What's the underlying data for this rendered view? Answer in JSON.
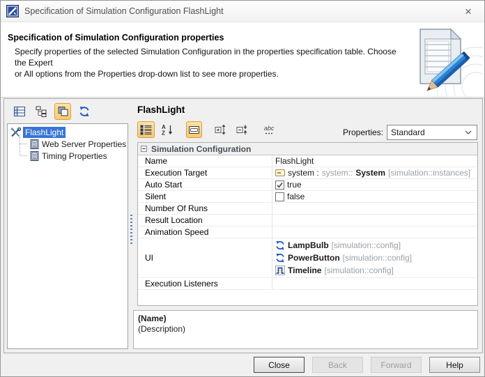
{
  "window": {
    "title": "Specification of Simulation Configuration FlashLight",
    "close_glyph": "×"
  },
  "header": {
    "title": "Specification of Simulation Configuration properties",
    "description_line1": "Specify properties of the selected Simulation Configuration in the properties specification table. Choose the Expert",
    "description_line2": "or All options from the Properties drop-down list to see more properties."
  },
  "left_panel": {
    "toolbar": [
      {
        "name": "element-list-button",
        "selected": false
      },
      {
        "name": "containment-tree-button",
        "selected": false
      },
      {
        "name": "group-view-button",
        "selected": true
      },
      {
        "name": "refresh-button",
        "selected": false
      }
    ],
    "tree": {
      "root_label": "FlashLight",
      "children": [
        "Web Server Properties",
        "Timing Properties"
      ]
    }
  },
  "main": {
    "title": "FlashLight",
    "toolbar": [
      {
        "name": "categorized-view-button",
        "selected": true
      },
      {
        "name": "sort-alphabetically-button",
        "selected": false
      },
      {
        "name": "show-description-button",
        "selected": true
      },
      {
        "name": "expand-nodes-button",
        "selected": false
      },
      {
        "name": "collapse-nodes-button",
        "selected": false
      },
      {
        "name": "customize-button",
        "selected": false
      }
    ],
    "properties": {
      "label": "Properties:",
      "value": "Standard"
    },
    "table": {
      "group_label": "Simulation Configuration",
      "rows": [
        {
          "label": "Name",
          "value": [
            {
              "t": "FlashLight"
            }
          ]
        },
        {
          "label": "Execution Target",
          "icon": "instance-icon",
          "value": [
            {
              "t": "system : "
            },
            {
              "t": "system::",
              "gray": true
            },
            {
              "t": "System",
              "bold": true
            },
            {
              "t": " [simulation::instances]",
              "gray": true
            }
          ]
        },
        {
          "label": "Auto Start",
          "checkbox": true,
          "checked": true,
          "value": [
            {
              "t": "true"
            }
          ]
        },
        {
          "label": "Silent",
          "checkbox": true,
          "checked": false,
          "value": [
            {
              "t": "false"
            }
          ]
        },
        {
          "label": "Number Of Runs",
          "value": []
        },
        {
          "label": "Result Location",
          "value": []
        },
        {
          "label": "Animation Speed",
          "value": []
        },
        {
          "label": "UI",
          "items": [
            {
              "icon": "config-refresh-icon",
              "name": "LampBulb",
              "suffix": " [simulation::config]"
            },
            {
              "icon": "config-refresh-icon",
              "name": "PowerButton",
              "suffix": " [simulation::config]"
            },
            {
              "icon": "timeline-icon",
              "name": "Timeline",
              "suffix": " [simulation::config]"
            }
          ]
        },
        {
          "label": "Execution Listeners",
          "value": []
        }
      ]
    },
    "name_panel": {
      "name_label": "(Name)",
      "description_label": "(Description)"
    }
  },
  "buttons": [
    {
      "label": "Close",
      "enabled": true,
      "default": true
    },
    {
      "label": "Back",
      "enabled": false
    },
    {
      "label": "Forward",
      "enabled": false
    },
    {
      "label": "Help",
      "enabled": true
    }
  ],
  "colors": {
    "selection_blue": "#3875d6",
    "toolbar_highlight": "#fac96e",
    "toolbar_highlight_border": "#d99e3f",
    "icon_blue": "#2456c6",
    "muted_gray": "#9aa0a8"
  }
}
